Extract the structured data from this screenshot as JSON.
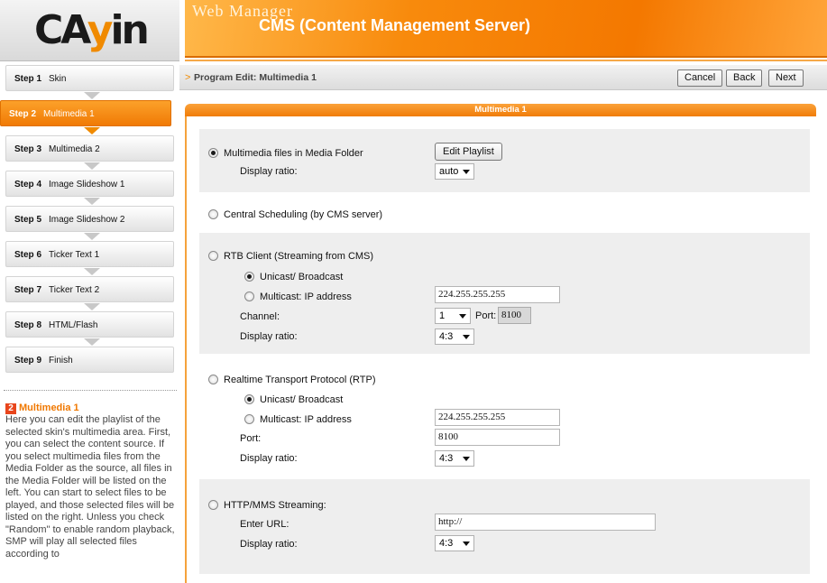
{
  "logo": {
    "text_a": "CA",
    "text_b": "y",
    "text_c": "in"
  },
  "banner": {
    "title1": "Web Manager",
    "title2": "CMS (Content Management Server)"
  },
  "toolbar": {
    "breadcrumb_arrow": ">",
    "breadcrumb": "Program Edit: Multimedia 1",
    "cancel_label": "Cancel",
    "back_label": "Back",
    "next_label": "Next"
  },
  "steps": [
    {
      "num": "Step 1",
      "label": "Skin"
    },
    {
      "num": "Step 2",
      "label": "Multimedia 1"
    },
    {
      "num": "Step 3",
      "label": "Multimedia 2"
    },
    {
      "num": "Step 4",
      "label": "Image Slideshow 1"
    },
    {
      "num": "Step 5",
      "label": "Image Slideshow 2"
    },
    {
      "num": "Step 6",
      "label": "Ticker Text 1"
    },
    {
      "num": "Step 7",
      "label": "Ticker Text 2"
    },
    {
      "num": "Step 8",
      "label": "HTML/Flash"
    },
    {
      "num": "Step 9",
      "label": "Finish"
    }
  ],
  "help": {
    "number": "2",
    "title": "Multimedia 1",
    "body": "Here you can edit the playlist of the selected skin's multimedia area. First, you can select the content source. If you select multimedia files from the Media Folder as the source, all files in the Media Folder will be listed on the left. You can start to select files to be played, and those selected files will be listed on the right. Unless you check \"Random\" to enable random playback, SMP will play all selected files according to"
  },
  "panel": {
    "title": "Multimedia 1",
    "media_folder": {
      "label": "Multimedia files in Media Folder",
      "edit_playlist": "Edit Playlist",
      "ratio_label": "Display ratio:",
      "ratio_value": "auto"
    },
    "central": {
      "label": "Central Scheduling (by CMS server)"
    },
    "rtb": {
      "label": "RTB Client (Streaming from CMS)",
      "unicast": "Unicast/ Broadcast",
      "multicast": "Multicast: IP address",
      "ip": "224.255.255.255",
      "channel_label": "Channel:",
      "channel_value": "1",
      "port_label": "Port:",
      "port_value": "8100",
      "ratio_label": "Display ratio:",
      "ratio_value": "4:3"
    },
    "rtp": {
      "label": "Realtime Transport Protocol (RTP)",
      "unicast": "Unicast/ Broadcast",
      "multicast": "Multicast: IP address",
      "ip": "224.255.255.255",
      "port_label": "Port:",
      "port_value": "8100",
      "ratio_label": "Display ratio:",
      "ratio_value": "4:3"
    },
    "http": {
      "label": "HTTP/MMS Streaming:",
      "url_label": "Enter URL:",
      "url_value": "http://",
      "ratio_label": "Display ratio:",
      "ratio_value": "4:3"
    }
  }
}
